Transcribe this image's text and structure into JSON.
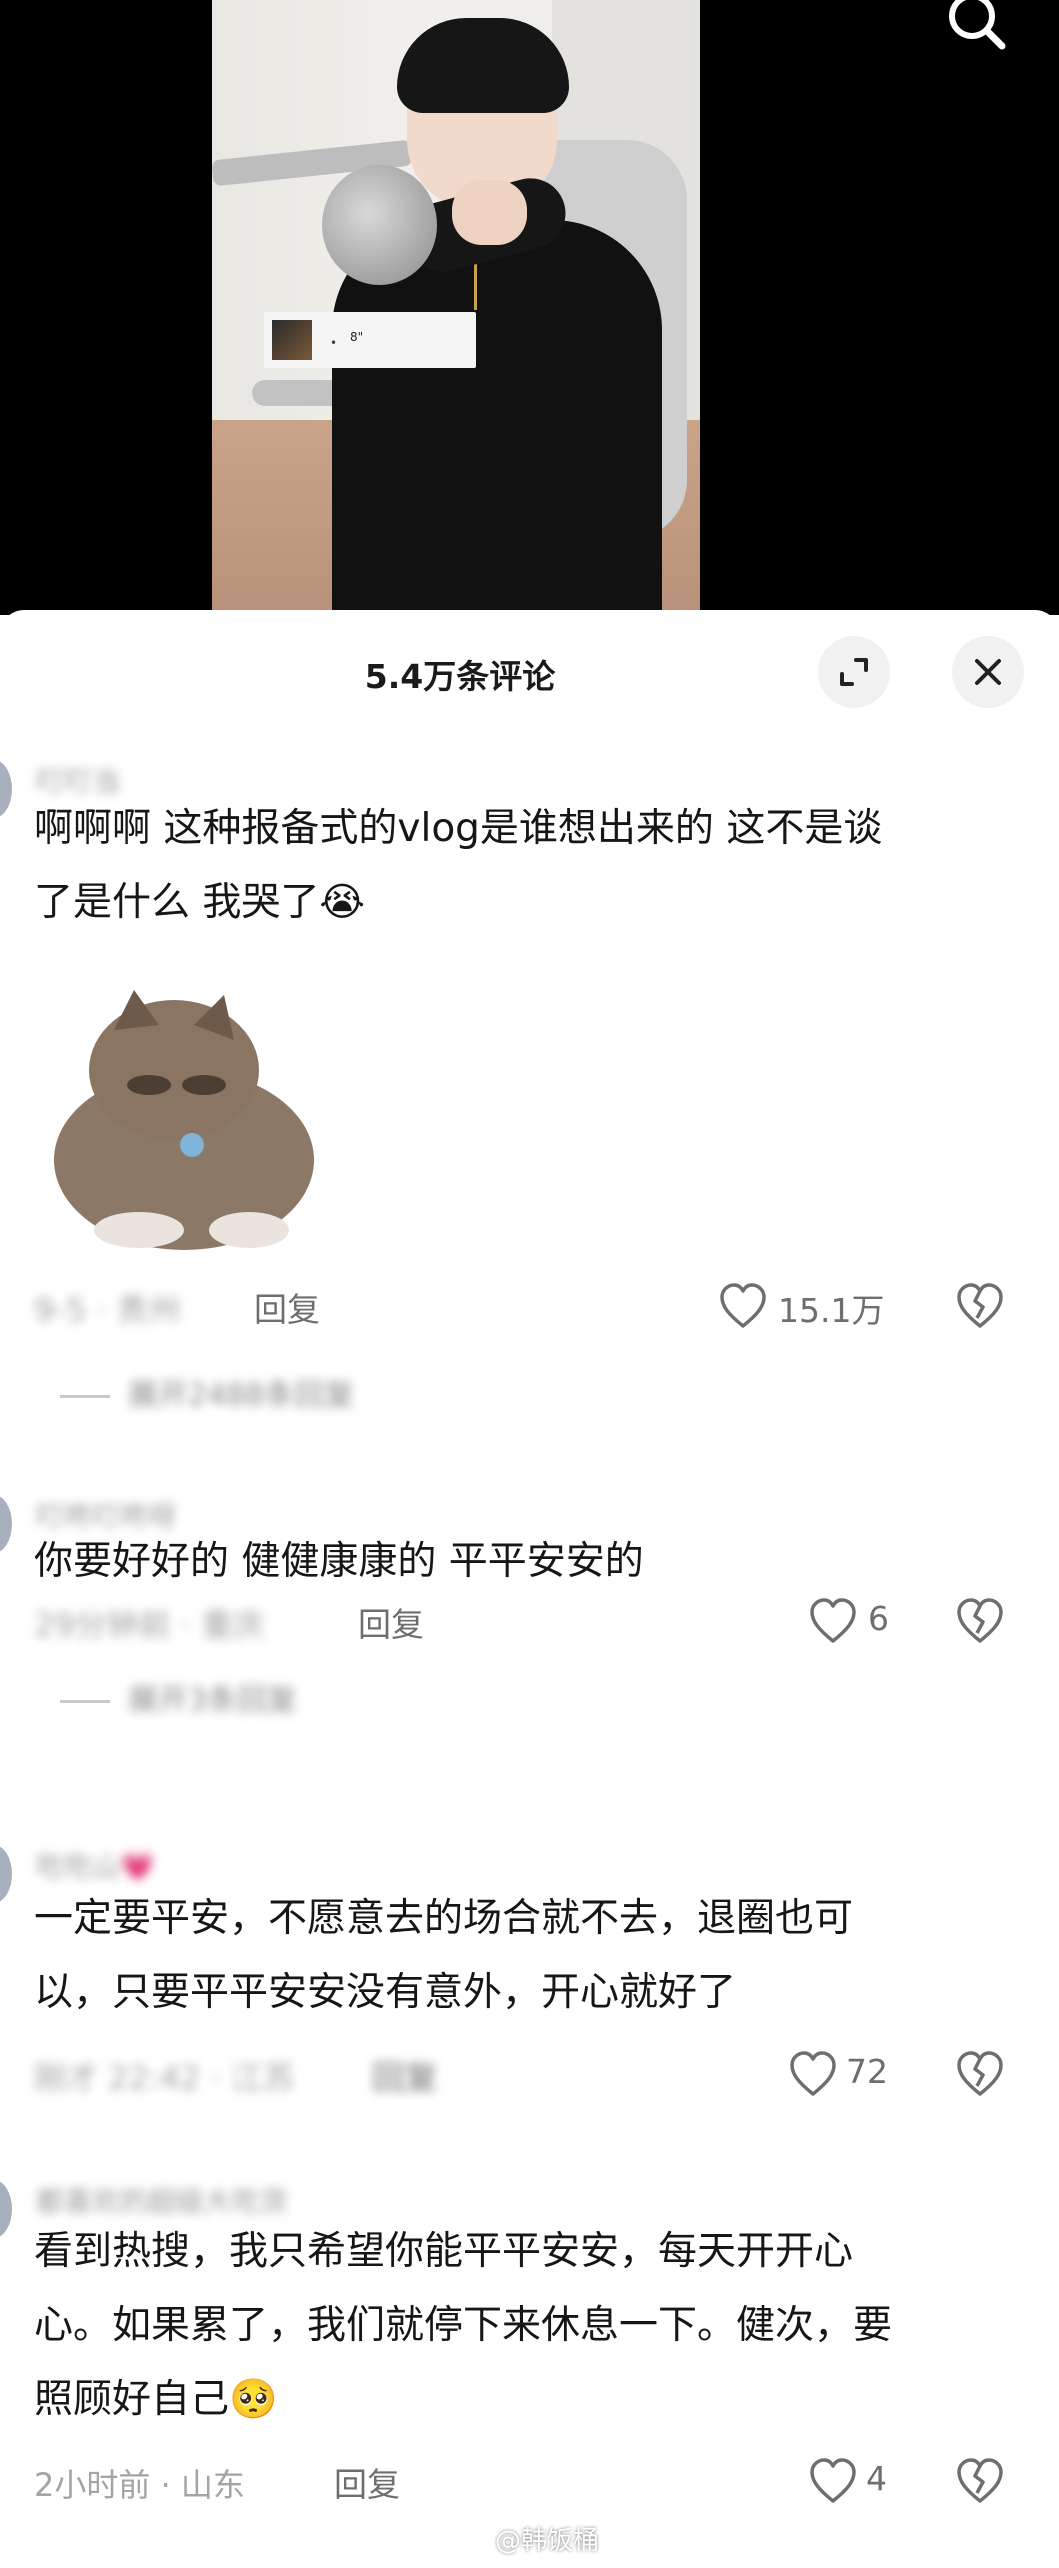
{
  "video": {
    "voice_bubble": {
      "dot": "•",
      "duration": "8\""
    }
  },
  "comments_panel": {
    "title": "5.4万条评论"
  },
  "comments": [
    {
      "username": "叮叮当",
      "text": [
        "啊啊啊 这种报备式的vlog是谁想出来的 这不是谈",
        "了是什么 我哭了😭"
      ],
      "time_location": "9-5 · 贵州",
      "reply_label": "回复",
      "likes": "15.1万",
      "expand_replies": "展开2488条回复"
    },
    {
      "username": "叮咚叮咚呀",
      "text": [
        "你要好好的 健健康康的 平平安安的"
      ],
      "time_location": "29分钟前 · 重庆",
      "reply_label": "回复",
      "likes": "6",
      "expand_replies": "展开3条回复"
    },
    {
      "username": "吃吃山💗",
      "text": [
        "一定要平安，不愿意去的场合就不去，退圈也可",
        "以，只要平平安安没有意外，开心就好了"
      ],
      "time_location": "刚才 22:42 · 江苏",
      "reply_label": "回复",
      "likes": "72"
    },
    {
      "username": "都喜欢的超级大吃货",
      "text": [
        "看到热搜，我只希望你能平平安安，每天开开心",
        "心。如果累了，我们就停下来休息一下。健次，要",
        "照顾好自己🥺"
      ],
      "time_location": "2小时前 · 山东",
      "reply_label": "回复",
      "likes": "4"
    }
  ],
  "watermark": "@韩饭桶",
  "colors": {
    "sheet_background": "#ffffff",
    "video_background": "#000000",
    "primary_text": "#161616",
    "secondary_text": "#a4a4a4",
    "round_button_bg": "#f1f1f1"
  },
  "icons": [
    "search-icon",
    "expand-icon",
    "close-icon",
    "heart-icon",
    "broken-heart-icon",
    "weibo-logo-icon"
  ]
}
